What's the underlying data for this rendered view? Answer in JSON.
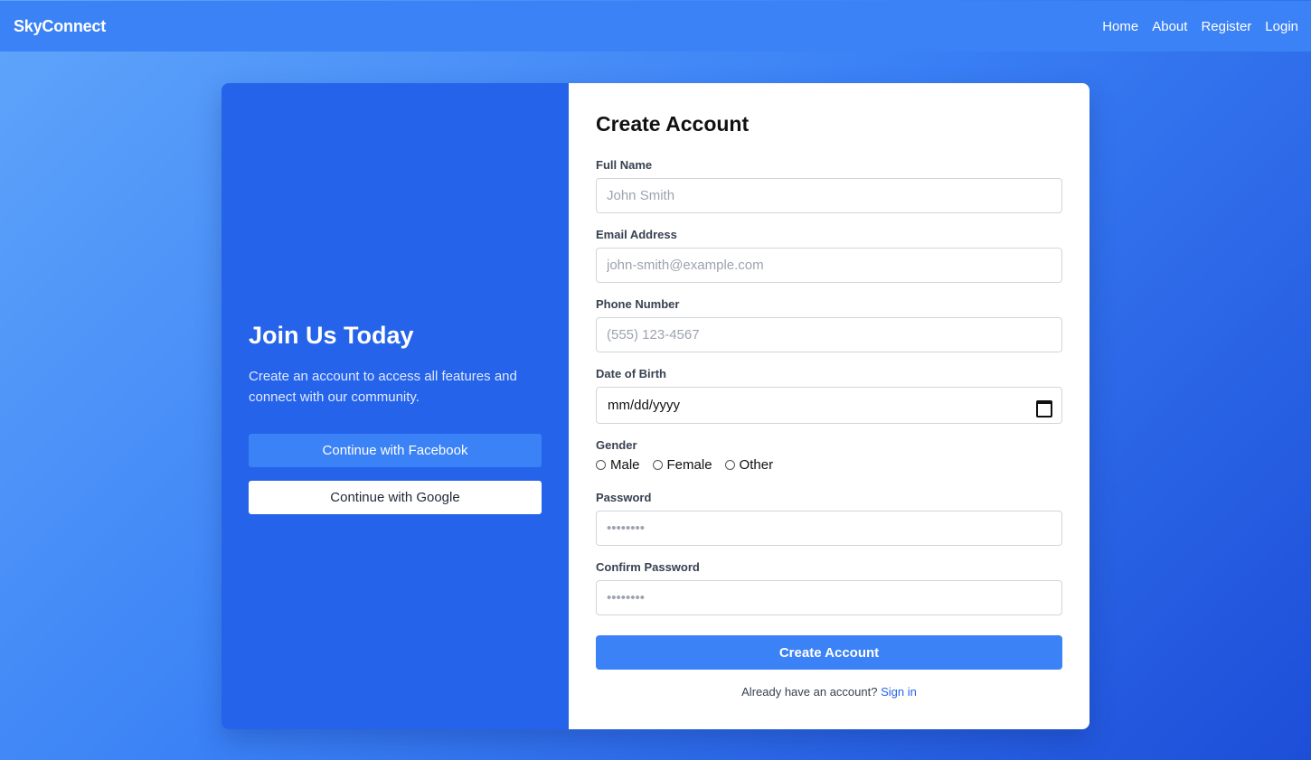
{
  "header": {
    "brand": "SkyConnect",
    "nav": [
      "Home",
      "About",
      "Register",
      "Login"
    ]
  },
  "promo": {
    "title": "Join Us Today",
    "text": "Create an account to access all features and connect with our community.",
    "facebook_label": "Continue with Facebook",
    "google_label": "Continue with Google"
  },
  "form": {
    "title": "Create Account",
    "full_name": {
      "label": "Full Name",
      "placeholder": "John Smith"
    },
    "email": {
      "label": "Email Address",
      "placeholder": "john-smith@example.com"
    },
    "phone": {
      "label": "Phone Number",
      "placeholder": "(555) 123-4567"
    },
    "dob": {
      "label": "Date of Birth",
      "value": "mm/dd/yyyy"
    },
    "gender": {
      "label": "Gender",
      "options": [
        "Male",
        "Female",
        "Other"
      ]
    },
    "password": {
      "label": "Password",
      "placeholder": "••••••••"
    },
    "confirm_password": {
      "label": "Confirm Password",
      "placeholder": "••••••••"
    },
    "submit_label": "Create Account",
    "signin_prompt": "Already have an account?",
    "signin_link": "Sign in"
  },
  "colors": {
    "accent": "#3b82f6",
    "panel": "#2563eb",
    "link": "#2563eb"
  }
}
